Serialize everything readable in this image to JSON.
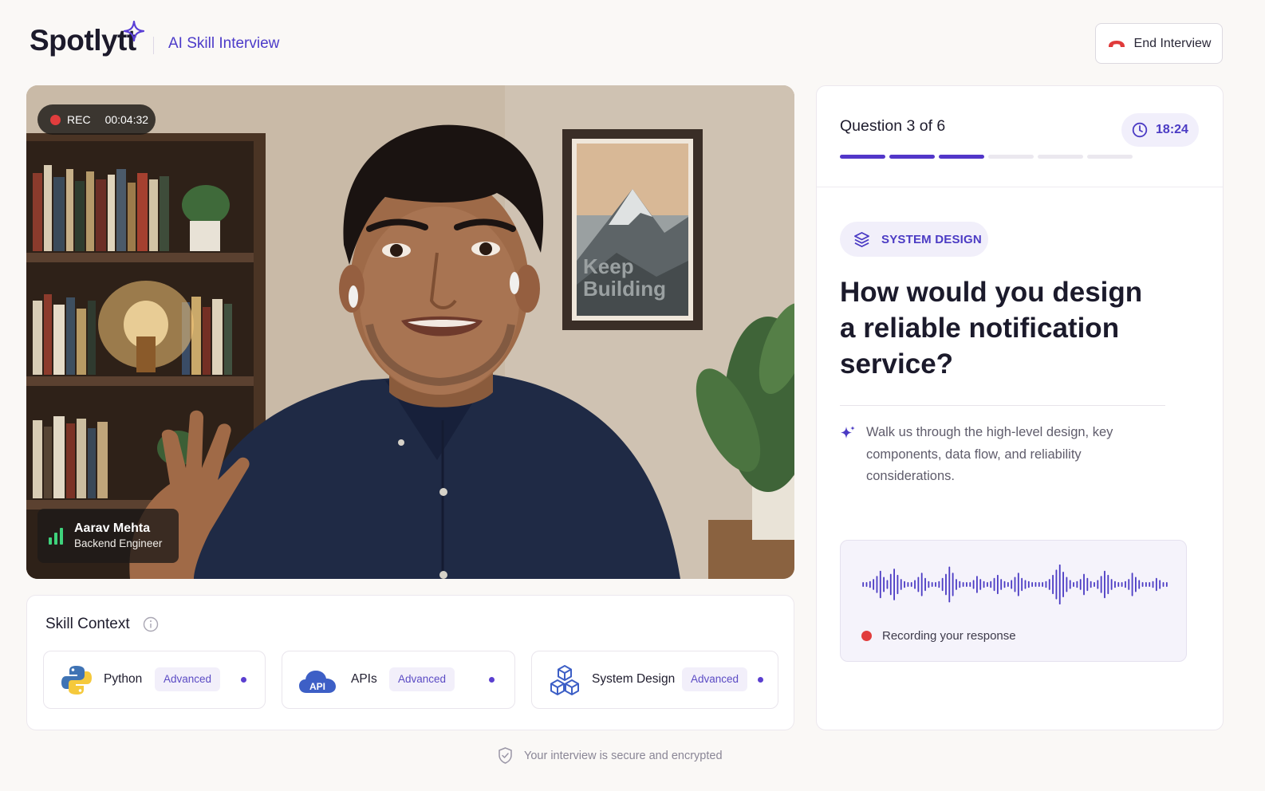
{
  "brand": {
    "logo": "Spotlytt",
    "subtitle": "AI Skill Interview"
  },
  "header": {
    "end_button_label": "End Interview"
  },
  "video": {
    "rec_label": "REC",
    "rec_time": "00:04:32",
    "poster_text_line1": "Keep",
    "poster_text_line2": "Building",
    "candidate": {
      "name": "Aarav Mehta",
      "role": "Backend Engineer"
    }
  },
  "skills": {
    "title": "Skill Context",
    "items": [
      {
        "name": "Python",
        "level": "Advanced",
        "icon": "python-icon"
      },
      {
        "name": "APIs",
        "level": "Advanced",
        "icon": "api-cloud-icon",
        "icon_text": "API"
      },
      {
        "name": "System Design",
        "level": "Advanced",
        "icon": "cubes-icon"
      }
    ]
  },
  "question": {
    "counter": "Question 3 of 6",
    "current": 3,
    "total": 6,
    "timer": "18:24",
    "category": "SYSTEM DESIGN",
    "text": "How would you design a reliable notification service?",
    "hint": "Walk us through the high-level design, key components, data flow, and reliability considerations.",
    "recording_status": "Recording your response"
  },
  "footer": {
    "secure_text": "Your interview is secure and encrypted"
  },
  "colors": {
    "accent": "#4b3bc4",
    "progress_done": "#5236c9",
    "progress_todo": "#ebe8ef",
    "recording_red": "#e13d3d",
    "audio_green": "#3fd27c"
  }
}
